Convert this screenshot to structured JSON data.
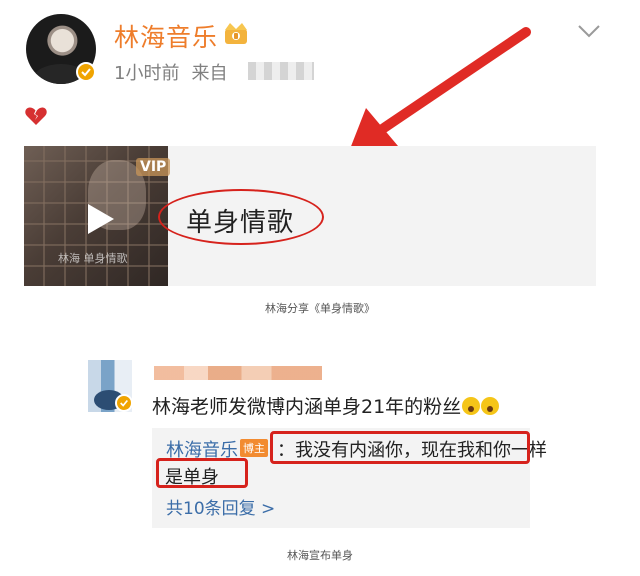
{
  "post": {
    "author": "林海音乐",
    "time": "1小时前",
    "source_prefix": "来自"
  },
  "music_card": {
    "song_title": "单身情歌",
    "vip_label": "VIP",
    "cover_text": "林海 单身情歌"
  },
  "captions": {
    "share": "林海分享《单身情歌》",
    "bottom": "林海宣布单身"
  },
  "comment": {
    "text": "林海老师发微博内涵单身21年的粉丝",
    "reply": {
      "author": "林海音乐",
      "badge": "博主",
      "separator": "：",
      "line1": "我没有内涵你，现在我和你一样",
      "line2": "是单身"
    },
    "more_replies": "共10条回复 >"
  },
  "colors": {
    "author_orange": "#ee7d2b",
    "link_blue": "#3b6da8",
    "annotation_red": "#d6221c",
    "card_bg": "#f3f3f3"
  },
  "icons": [
    "crown-icon",
    "verified-icon",
    "chevron-down-icon",
    "broken-heart-icon",
    "play-icon",
    "red-arrow-annotation"
  ]
}
